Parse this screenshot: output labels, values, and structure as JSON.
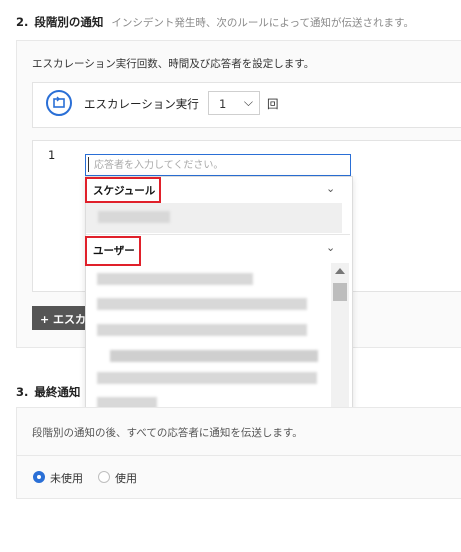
{
  "section2": {
    "number": "2.",
    "title": "段階別の通知",
    "description": "インシデント発生時、次のルールによって通知が伝送されます。"
  },
  "escalation": {
    "instruction": "エスカレーション実行回数、時間及び応答者を設定します。",
    "label": "エスカレーション実行",
    "count_value": "1",
    "unit": "回"
  },
  "rule_row": {
    "number": "1",
    "responder_placeholder": "応答者を入力してください。"
  },
  "dropdown": {
    "groups": [
      {
        "label": "スケジュール"
      },
      {
        "label": "ユーザー"
      }
    ]
  },
  "add_button_label": "+ エスカ",
  "section3": {
    "number": "3.",
    "title": "最終通知",
    "description": "段階別の通知の後、すべての応答者に通知を伝送します。",
    "options": [
      {
        "label": "未使用",
        "selected": true
      },
      {
        "label": "使用",
        "selected": false
      }
    ]
  },
  "colors": {
    "accent": "#2a6fd6",
    "highlight": "#e0202a",
    "button_bg": "#555555"
  }
}
